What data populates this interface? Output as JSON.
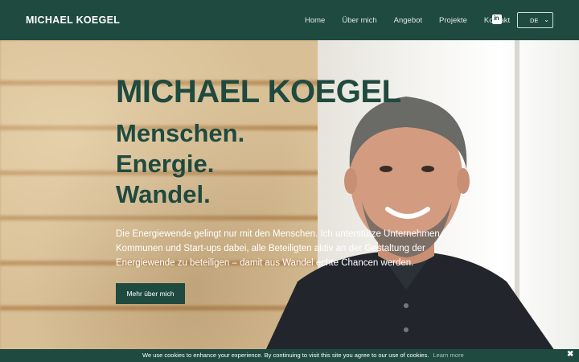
{
  "header": {
    "brand": "MICHAEL KOEGEL",
    "nav": [
      "Home",
      "Über mich",
      "Angebot",
      "Projekte",
      "Kontakt"
    ],
    "social_icon": "linkedin-icon",
    "social_label": "in",
    "language": "DE"
  },
  "hero": {
    "name": "MICHAEL KOEGEL",
    "lines": [
      "Menschen.",
      "Energie.",
      "Wandel."
    ],
    "text": "Die Energiewende gelingt nur mit den Menschen. Ich unterstütze Unternehmen, Kommunen und Start-ups dabei, alle Beteiligten aktiv an der Gestaltung der Energiewende zu beteiligen – damit aus Wandel echte Chancen werden.",
    "button": "Mehr über mich"
  },
  "cookie": {
    "text": "We use cookies to enhance your experience. By continuing to visit this site you agree to our use of cookies.",
    "link": "Learn more",
    "close": "✖"
  },
  "colors": {
    "primary": "#1f4a3f",
    "text_light": "#ffffff"
  }
}
